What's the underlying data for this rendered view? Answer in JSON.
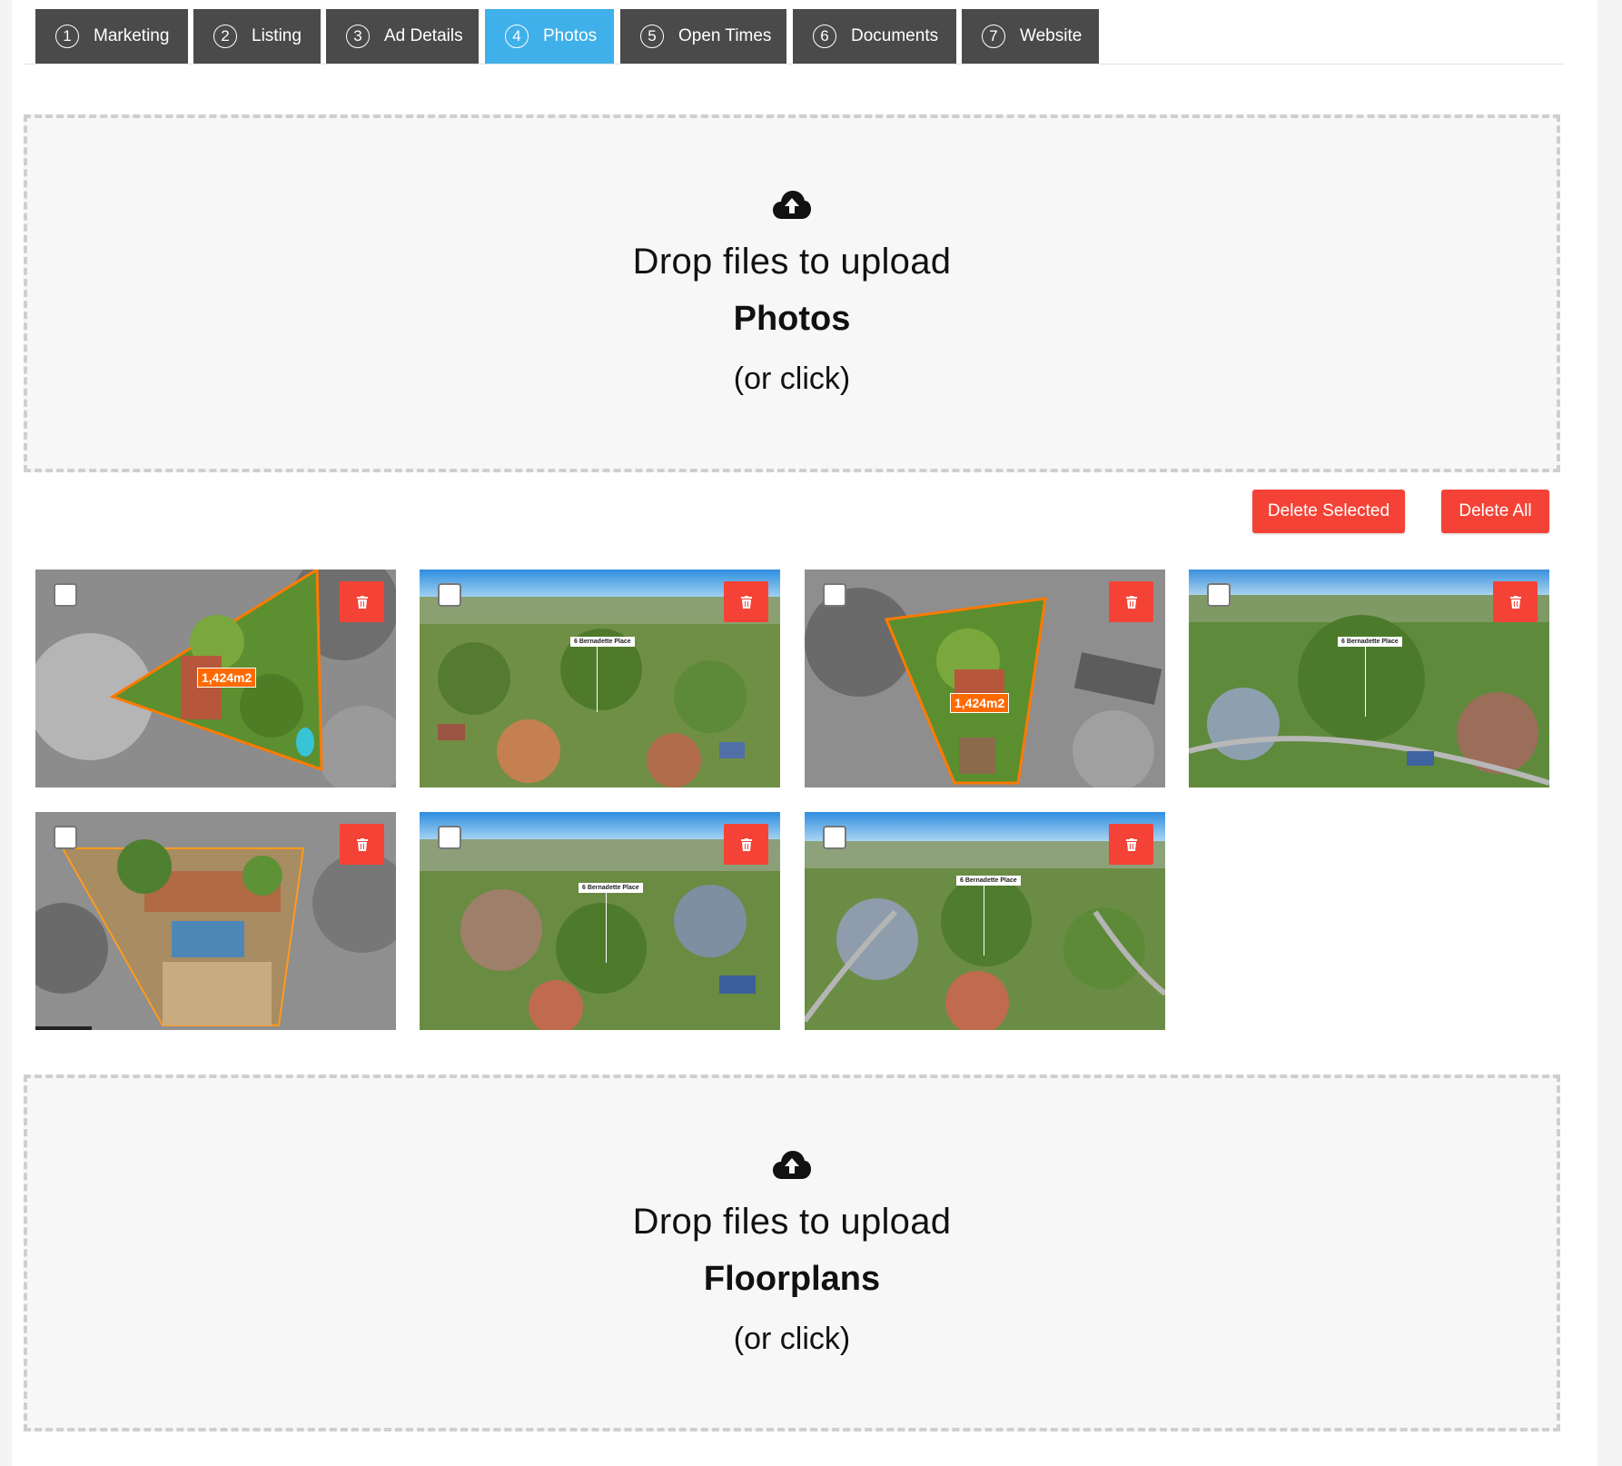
{
  "tabs": [
    {
      "num": "1",
      "label": "Marketing"
    },
    {
      "num": "2",
      "label": "Listing"
    },
    {
      "num": "3",
      "label": "Ad Details"
    },
    {
      "num": "4",
      "label": "Photos"
    },
    {
      "num": "5",
      "label": "Open Times"
    },
    {
      "num": "6",
      "label": "Documents"
    },
    {
      "num": "7",
      "label": "Website"
    }
  ],
  "active_tab": "Photos",
  "photos_dropzone": {
    "line1": "Drop files to upload",
    "title": "Photos",
    "line3": "(or click)"
  },
  "floorplans_dropzone": {
    "line1": "Drop files to upload",
    "title": "Floorplans",
    "line3": "(or click)"
  },
  "actions": {
    "delete_selected": "Delete Selected",
    "delete_all": "Delete All"
  },
  "photos": [
    {
      "tag": "1,424m2",
      "label": ""
    },
    {
      "tag": "",
      "label": "6 Bernadette Place"
    },
    {
      "tag": "1,424m2",
      "label": ""
    },
    {
      "tag": "",
      "label": "6 Bernadette Place"
    },
    {
      "tag": "",
      "label": ""
    },
    {
      "tag": "",
      "label": "6 Bernadette Place"
    },
    {
      "tag": "",
      "label": "6 Bernadette Place"
    }
  ],
  "icons": {
    "upload": "cloud-upload-icon",
    "delete": "trash-icon"
  },
  "colors": {
    "tab_active": "#3fb0ea",
    "tab_inactive": "#4a4a4a",
    "danger": "#f44336"
  }
}
